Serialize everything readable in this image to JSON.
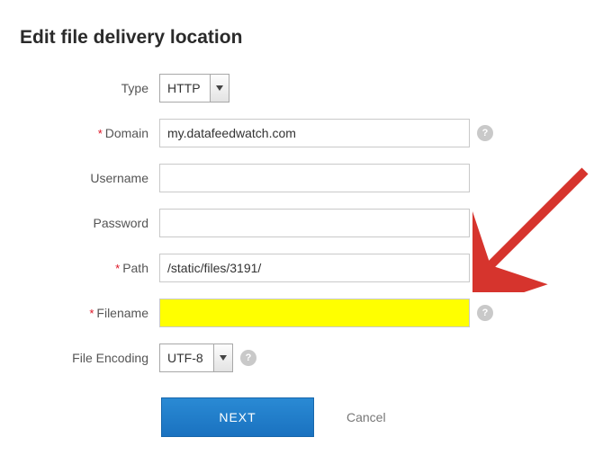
{
  "title": "Edit file delivery location",
  "fields": {
    "type": {
      "label": "Type",
      "value": "HTTP",
      "required": false
    },
    "domain": {
      "label": "Domain",
      "value": "my.datafeedwatch.com",
      "required": true
    },
    "username": {
      "label": "Username",
      "value": "",
      "required": false
    },
    "password": {
      "label": "Password",
      "value": "",
      "required": false
    },
    "path": {
      "label": "Path",
      "value": "/static/files/3191/",
      "required": true
    },
    "filename": {
      "label": "Filename",
      "value": "",
      "required": true
    },
    "encoding": {
      "label": "File Encoding",
      "value": "UTF-8",
      "required": false
    }
  },
  "actions": {
    "next": "NEXT",
    "cancel": "Cancel"
  },
  "colors": {
    "highlight": "#ffff00",
    "arrow": "#d6342d"
  }
}
